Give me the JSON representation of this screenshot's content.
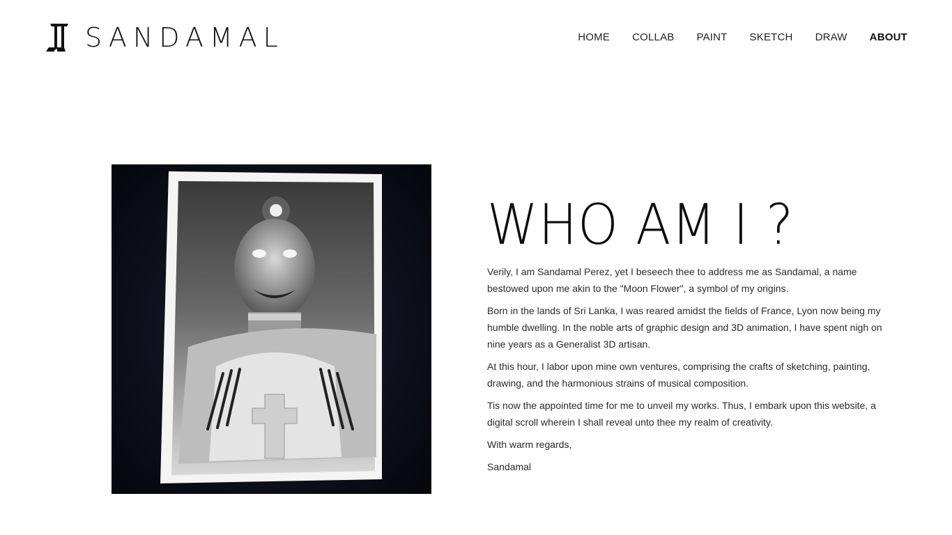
{
  "brand": {
    "name": "SANDAMAL",
    "logo_icon": "sandamal-monogram-icon"
  },
  "nav": {
    "items": [
      {
        "label": "HOME",
        "active": false
      },
      {
        "label": "COLLAB",
        "active": false
      },
      {
        "label": "PAINT",
        "active": false
      },
      {
        "label": "SKETCH",
        "active": false
      },
      {
        "label": "DRAW",
        "active": false
      },
      {
        "label": "ABOUT",
        "active": true
      }
    ]
  },
  "about": {
    "heading": "WHO AM I ?",
    "paragraphs": [
      "Verily, I am Sandamal Perez, yet I beseech thee to address me as Sandamal, a name bestowed upon me akin to the \"Moon Flower\", a symbol of my origins.",
      "Born in the lands of Sri Lanka, I was reared amidst the fields of France, Lyon now being my humble dwelling. In the noble arts of graphic design and 3D animation, I have spent nigh on nine years as a Generalist 3D artisan.",
      "At this hour, I labor upon mine own ventures, comprising the crafts of sketching, painting, drawing, and the harmonious strains of musical composition.",
      "Tis now the appointed time for me to unveil my works. Thus, I embark upon this website, a digital scroll wherein I shall reveal unto thee my realm of creativity.",
      "With warm regards,",
      "Sandamal"
    ]
  },
  "colors": {
    "background": "#ffffff",
    "text": "#1a1a1a",
    "photo_backdrop": "#0b0e1a"
  }
}
